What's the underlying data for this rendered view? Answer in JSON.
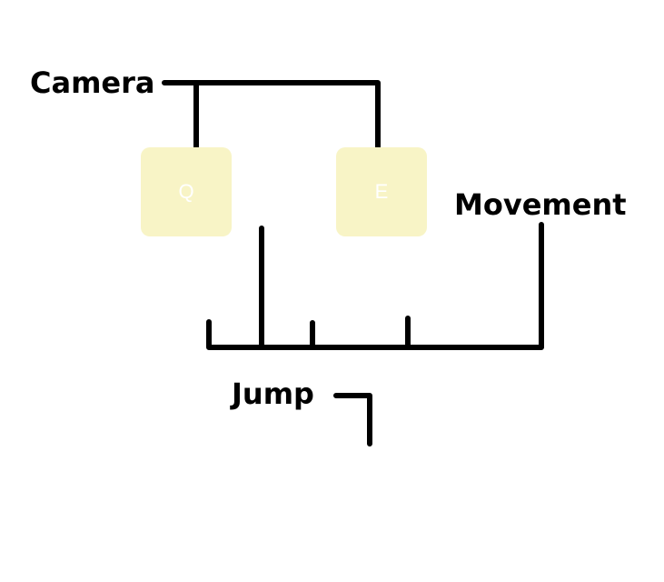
{
  "labels": {
    "camera": "Camera",
    "movement": "Movement",
    "jump": "Jump"
  },
  "keys": {
    "q": "Q",
    "e": "E"
  },
  "colors": {
    "key_fill": "#f8f4c6",
    "key_text": "#ffffff",
    "line": "#000000"
  }
}
